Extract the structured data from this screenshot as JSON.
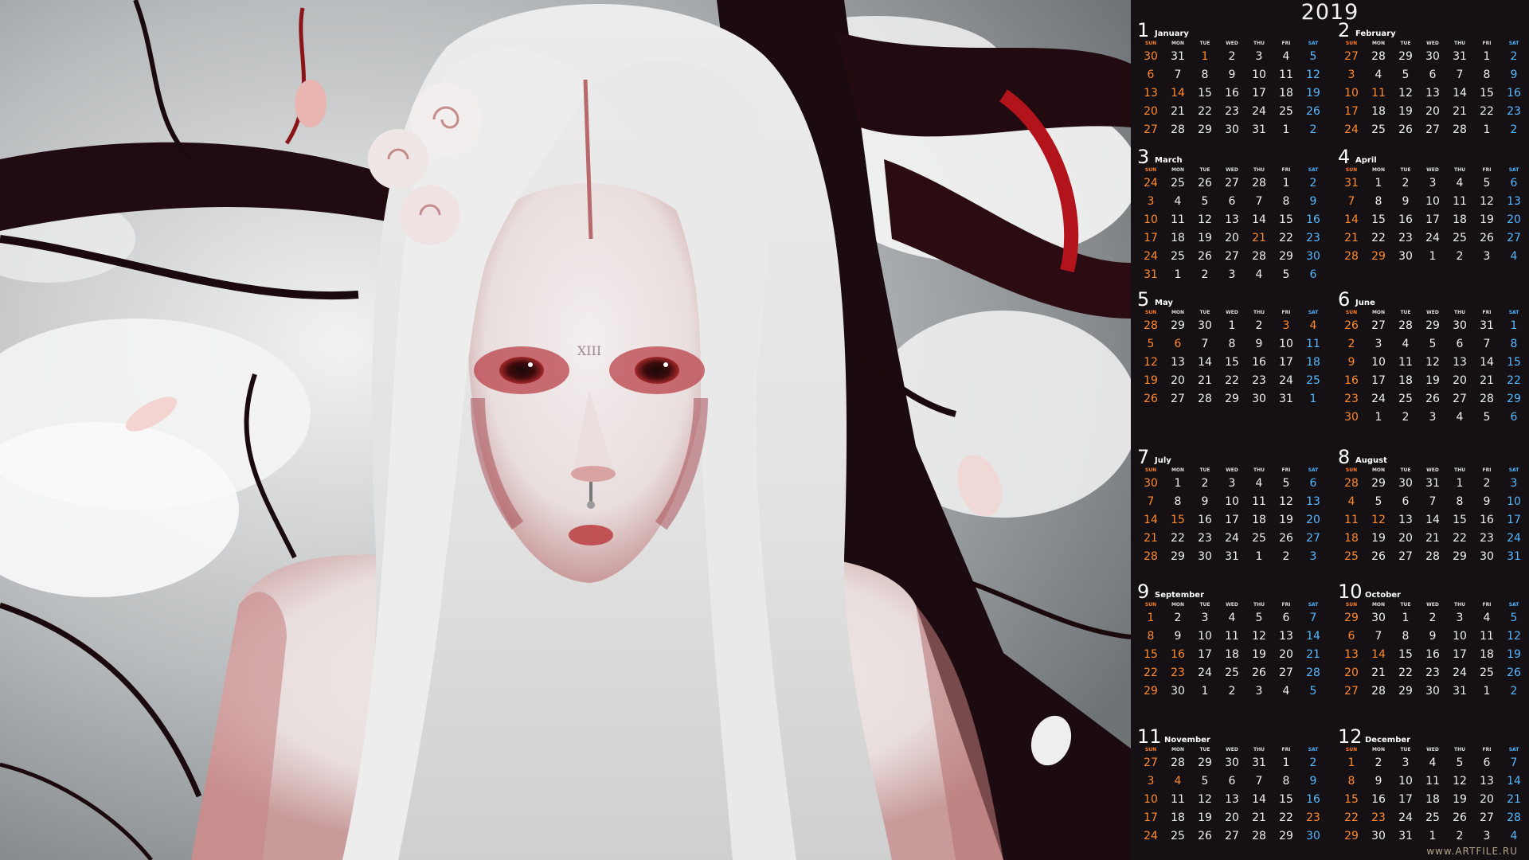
{
  "calendar": {
    "year": "2019",
    "dow_labels": [
      "SUN",
      "MON",
      "TUE",
      "WED",
      "THU",
      "FRI",
      "SAT"
    ],
    "months": [
      {
        "num": "1",
        "name": "January",
        "days": [
          "30",
          "31",
          "1",
          "2",
          "3",
          "4",
          "5",
          "6",
          "7",
          "8",
          "9",
          "10",
          "11",
          "12",
          "13",
          "14",
          "15",
          "16",
          "17",
          "18",
          "19",
          "20",
          "21",
          "22",
          "23",
          "24",
          "25",
          "26",
          "27",
          "28",
          "29",
          "30",
          "31",
          "1",
          "2"
        ]
      },
      {
        "num": "2",
        "name": "February",
        "days": [
          "27",
          "28",
          "29",
          "30",
          "31",
          "1",
          "2",
          "3",
          "4",
          "5",
          "6",
          "7",
          "8",
          "9",
          "10",
          "11",
          "12",
          "13",
          "14",
          "15",
          "16",
          "17",
          "18",
          "19",
          "20",
          "21",
          "22",
          "23",
          "24",
          "25",
          "26",
          "27",
          "28",
          "1",
          "2"
        ]
      },
      {
        "num": "3",
        "name": "March",
        "days": [
          "24",
          "25",
          "26",
          "27",
          "28",
          "1",
          "2",
          "3",
          "4",
          "5",
          "6",
          "7",
          "8",
          "9",
          "10",
          "11",
          "12",
          "13",
          "14",
          "15",
          "16",
          "17",
          "18",
          "19",
          "20",
          "21",
          "22",
          "23",
          "24",
          "25",
          "26",
          "27",
          "28",
          "29",
          "30",
          "31",
          "1",
          "2",
          "3",
          "4",
          "5",
          "6"
        ]
      },
      {
        "num": "4",
        "name": "April",
        "days": [
          "31",
          "1",
          "2",
          "3",
          "4",
          "5",
          "6",
          "7",
          "8",
          "9",
          "10",
          "11",
          "12",
          "13",
          "14",
          "15",
          "16",
          "17",
          "18",
          "19",
          "20",
          "21",
          "22",
          "23",
          "24",
          "25",
          "26",
          "27",
          "28",
          "29",
          "30",
          "1",
          "2",
          "3",
          "4"
        ]
      },
      {
        "num": "5",
        "name": "May",
        "days": [
          "28",
          "29",
          "30",
          "1",
          "2",
          "3",
          "4",
          "5",
          "6",
          "7",
          "8",
          "9",
          "10",
          "11",
          "12",
          "13",
          "14",
          "15",
          "16",
          "17",
          "18",
          "19",
          "20",
          "21",
          "22",
          "23",
          "24",
          "25",
          "26",
          "27",
          "28",
          "29",
          "30",
          "31",
          "1"
        ]
      },
      {
        "num": "6",
        "name": "June",
        "days": [
          "26",
          "27",
          "28",
          "29",
          "30",
          "31",
          "1",
          "2",
          "3",
          "4",
          "5",
          "6",
          "7",
          "8",
          "9",
          "10",
          "11",
          "12",
          "13",
          "14",
          "15",
          "16",
          "17",
          "18",
          "19",
          "20",
          "21",
          "22",
          "23",
          "24",
          "25",
          "26",
          "27",
          "28",
          "29",
          "30",
          "1",
          "2",
          "3",
          "4",
          "5",
          "6"
        ]
      },
      {
        "num": "7",
        "name": "July",
        "days": [
          "30",
          "1",
          "2",
          "3",
          "4",
          "5",
          "6",
          "7",
          "8",
          "9",
          "10",
          "11",
          "12",
          "13",
          "14",
          "15",
          "16",
          "17",
          "18",
          "19",
          "20",
          "21",
          "22",
          "23",
          "24",
          "25",
          "26",
          "27",
          "28",
          "29",
          "30",
          "31",
          "1",
          "2",
          "3"
        ]
      },
      {
        "num": "8",
        "name": "August",
        "days": [
          "28",
          "29",
          "30",
          "31",
          "1",
          "2",
          "3",
          "4",
          "5",
          "6",
          "7",
          "8",
          "9",
          "10",
          "11",
          "12",
          "13",
          "14",
          "15",
          "16",
          "17",
          "18",
          "19",
          "20",
          "21",
          "22",
          "23",
          "24",
          "25",
          "26",
          "27",
          "28",
          "29",
          "30",
          "31"
        ]
      },
      {
        "num": "9",
        "name": "September",
        "days": [
          "1",
          "2",
          "3",
          "4",
          "5",
          "6",
          "7",
          "8",
          "9",
          "10",
          "11",
          "12",
          "13",
          "14",
          "15",
          "16",
          "17",
          "18",
          "19",
          "20",
          "21",
          "22",
          "23",
          "24",
          "25",
          "26",
          "27",
          "28",
          "29",
          "30",
          "1",
          "2",
          "3",
          "4",
          "5"
        ]
      },
      {
        "num": "10",
        "name": "October",
        "days": [
          "29",
          "30",
          "1",
          "2",
          "3",
          "4",
          "5",
          "6",
          "7",
          "8",
          "9",
          "10",
          "11",
          "12",
          "13",
          "14",
          "15",
          "16",
          "17",
          "18",
          "19",
          "20",
          "21",
          "22",
          "23",
          "24",
          "25",
          "26",
          "27",
          "28",
          "29",
          "30",
          "31",
          "1",
          "2"
        ]
      },
      {
        "num": "11",
        "name": "November",
        "days": [
          "27",
          "28",
          "29",
          "30",
          "31",
          "1",
          "2",
          "3",
          "4",
          "5",
          "6",
          "7",
          "8",
          "9",
          "10",
          "11",
          "12",
          "13",
          "14",
          "15",
          "16",
          "17",
          "18",
          "19",
          "20",
          "21",
          "22",
          "23",
          "24",
          "25",
          "26",
          "27",
          "28",
          "29",
          "30"
        ]
      },
      {
        "num": "12",
        "name": "December",
        "days": [
          "1",
          "2",
          "3",
          "4",
          "5",
          "6",
          "7",
          "8",
          "9",
          "10",
          "11",
          "12",
          "13",
          "14",
          "15",
          "16",
          "17",
          "18",
          "19",
          "20",
          "21",
          "22",
          "23",
          "24",
          "25",
          "26",
          "27",
          "28",
          "29",
          "30",
          "31",
          "1",
          "2",
          "3",
          "4"
        ]
      }
    ],
    "holidays": {
      "1": [
        "1",
        "14"
      ],
      "2": [
        "11"
      ],
      "3": [
        "21"
      ],
      "4": [
        "29"
      ],
      "5": [
        "3",
        "4",
        "5",
        "6"
      ],
      "7": [
        "15"
      ],
      "8": [
        "12"
      ],
      "9": [
        "16",
        "23"
      ],
      "10": [
        "14"
      ],
      "11": [
        "4",
        "23"
      ],
      "12": [
        "23"
      ]
    }
  },
  "artwork": {
    "forehead_text": "XIII"
  },
  "watermark": "www.ARTFILE.RU"
}
